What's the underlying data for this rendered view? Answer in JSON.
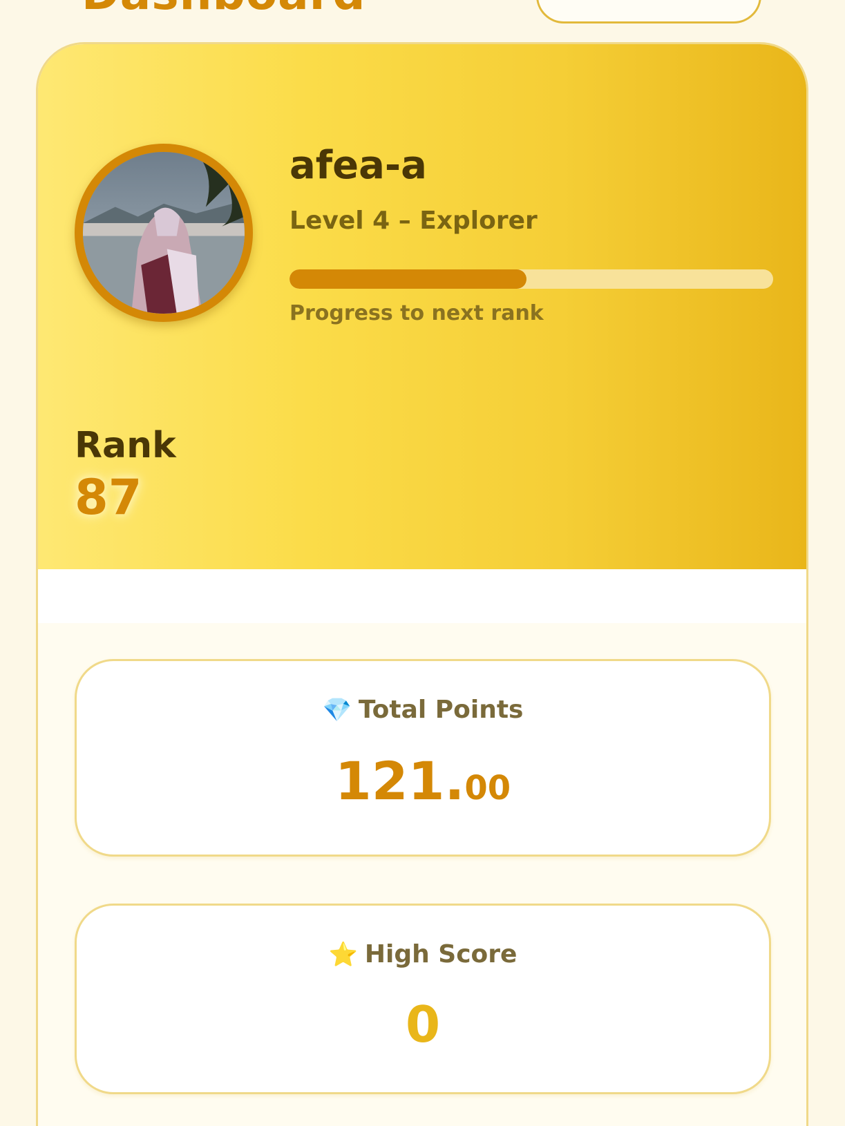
{
  "header": {
    "title": "Dashboard"
  },
  "profile": {
    "username": "afea-a",
    "level": "Level 4 – Explorer",
    "progress_fraction": 0.49,
    "progress_caption": "Progress to next rank",
    "rank_label": "Rank",
    "rank_value": "87"
  },
  "stats": {
    "total_points": {
      "icon": "💎",
      "label": "Total Points",
      "int_part": "121.",
      "dec_part": "00"
    },
    "high_score": {
      "icon": "⭐",
      "label": "High Score",
      "value": "0"
    }
  },
  "colors": {
    "accent": "#d48806",
    "hero_start": "#fee873",
    "hero_end": "#e9b61a",
    "text_dark": "#4a3706"
  }
}
